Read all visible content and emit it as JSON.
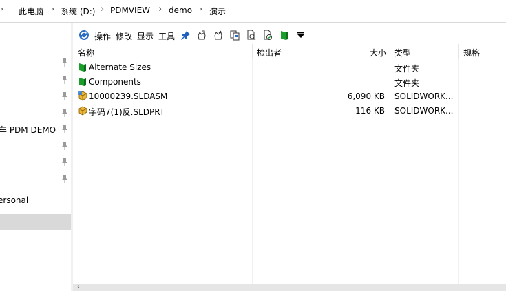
{
  "breadcrumb": {
    "items": [
      "此电脑",
      "系统 (D:)",
      "PDMVIEW",
      "demo",
      "演示"
    ],
    "separator": "›"
  },
  "nav": {
    "items": [
      {
        "label": "车 PDM DEMO"
      },
      {
        "label": "ersonal"
      }
    ]
  },
  "toolbar": {
    "menu": [
      "操作",
      "修改",
      "显示",
      "工具"
    ],
    "icons": [
      "pdm-refresh-icon",
      "pin-icon",
      "checkout-icon",
      "checkin-icon",
      "copy-tree-icon",
      "search-file-icon",
      "get-version-icon",
      "folder-green-icon",
      "dropdown-arrow-icon"
    ]
  },
  "columns": {
    "name": "名称",
    "checked_out_by": "检出者",
    "size": "大小",
    "type": "类型",
    "spec": "规格"
  },
  "files": [
    {
      "name": "Alternate Sizes",
      "checked_out_by": "",
      "size": "",
      "type": "文件夹",
      "icon": "green-folder-icon"
    },
    {
      "name": "Components",
      "checked_out_by": "",
      "size": "",
      "type": "文件夹",
      "icon": "green-folder-icon"
    },
    {
      "name": "10000239.SLDASM",
      "checked_out_by": "",
      "size": "6,090 KB",
      "type": "SOLIDWORK...",
      "icon": "assembly-icon"
    },
    {
      "name": "字码7(1)反.SLDPRT",
      "checked_out_by": "",
      "size": "116 KB",
      "type": "SOLIDWORK...",
      "icon": "part-icon"
    }
  ],
  "colors": {
    "folder_green": "#1a9d2b",
    "selected_nav": "#d9d9d9",
    "pin_blue": "#1f5fbf"
  }
}
